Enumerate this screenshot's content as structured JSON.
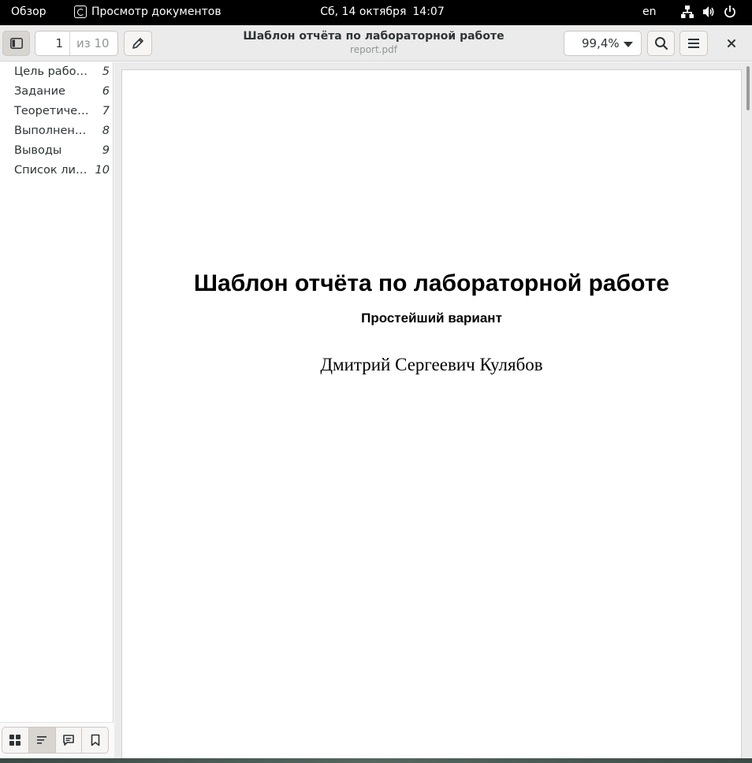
{
  "topbar": {
    "activities": "Обзор",
    "app_name": "Просмотр документов",
    "date": "Сб, 14 октября",
    "time": "14:07",
    "lang": "en",
    "tray_icons": [
      "network-icon",
      "volume-icon",
      "power-icon"
    ]
  },
  "headerbar": {
    "current_page": "1",
    "total_pages": "из 10",
    "title": "Шаблон отчёта по лабораторной работе",
    "filename": "report.pdf",
    "zoom": "99,4%"
  },
  "sidebar": {
    "outline": [
      {
        "label": "Цель работы",
        "page": "5"
      },
      {
        "label": "Задание",
        "page": "6"
      },
      {
        "label": "Теоретическое введение",
        "page": "7"
      },
      {
        "label": "Выполнение лабораторной работы",
        "page": "8"
      },
      {
        "label": "Выводы",
        "page": "9"
      },
      {
        "label": "Список литературы",
        "page": "10"
      }
    ]
  },
  "document": {
    "title": "Шаблон отчёта по лабораторной работе",
    "subtitle": "Простейший вариант",
    "author": "Дмитрий Сергеевич Кулябов"
  }
}
